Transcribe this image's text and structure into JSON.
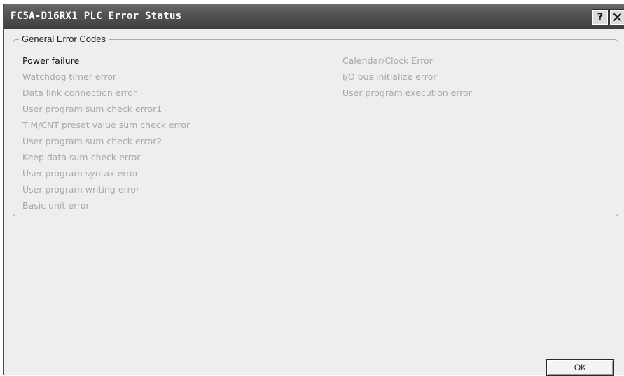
{
  "window": {
    "title": "FC5A-D16RX1 PLC Error Status",
    "help_label": "?",
    "close_icon": "close-icon"
  },
  "group": {
    "label": "General Error Codes"
  },
  "errors_left": [
    {
      "label": "Power failure",
      "active": true
    },
    {
      "label": "Watchdog timer error",
      "active": false
    },
    {
      "label": "Data link connection error",
      "active": false
    },
    {
      "label": "User program sum check error1",
      "active": false
    },
    {
      "label": "TIM/CNT preset value sum check error",
      "active": false
    },
    {
      "label": "User program sum check error2",
      "active": false
    },
    {
      "label": "Keep data sum check error",
      "active": false
    },
    {
      "label": "User program syntax error",
      "active": false
    },
    {
      "label": "User program writing error",
      "active": false
    },
    {
      "label": "Basic unit error",
      "active": false
    }
  ],
  "errors_right": [
    {
      "label": "Calendar/Clock Error",
      "active": false
    },
    {
      "label": "I/O bus initialize error",
      "active": false
    },
    {
      "label": "User program execution error",
      "active": false
    }
  ],
  "buttons": {
    "ok_label": "OK"
  },
  "colors": {
    "active_text": "#151515",
    "inactive_text": "#a8a8a8",
    "titlebar": "#4a4a4a",
    "window_bg": "#eeeeee"
  }
}
